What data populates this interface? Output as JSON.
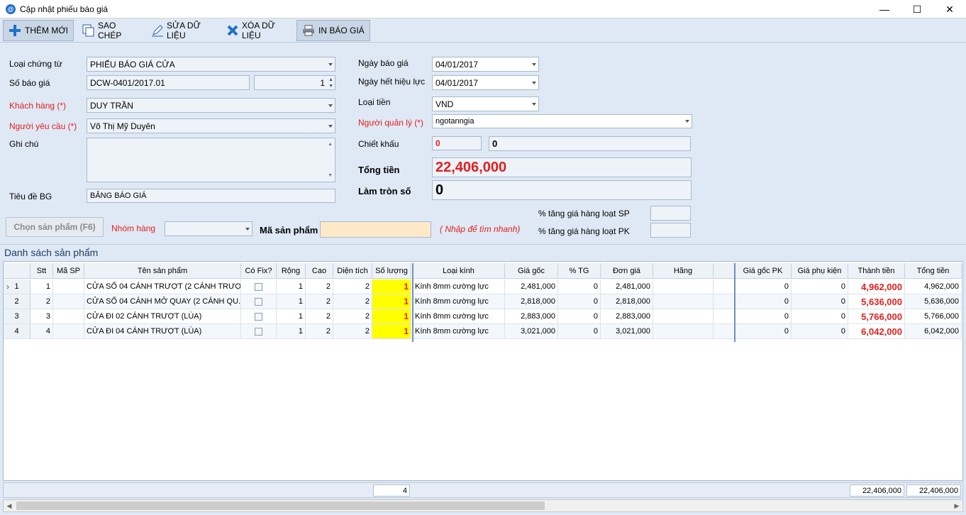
{
  "window": {
    "title": "Cập nhật phiếu báo giá"
  },
  "toolbar": {
    "add": "THÊM MỚI",
    "copy": "SAO CHÉP",
    "edit": "SỬA DỮ LIỆU",
    "delete": "XÓA DỮ LIỆU",
    "print": "IN BÁO GIÁ"
  },
  "form": {
    "doc_type_label": "Loại chứng từ",
    "doc_type_value": "PHIẾU BÁO GIÁ CỬA",
    "quote_no_label": "Số báo giá",
    "quote_no_value": "DCW-0401/2017.01",
    "quote_seq_value": "1",
    "customer_label": "Khách hàng (*)",
    "customer_value": "DUY TRẦN",
    "requester_label": "Người yêu cầu (*)",
    "requester_value": "Võ Thị Mỹ Duyên",
    "note_label": "Ghi chú",
    "note_value": "",
    "title_label": "Tiêu đề BG",
    "title_value": "BẢNG BÁO GIÁ",
    "quote_date_label": "Ngày báo giá",
    "quote_date_value": "04/01/2017",
    "expiry_label": "Ngày hết hiệu lực",
    "expiry_value": "04/01/2017",
    "currency_label": "Loại tiền",
    "currency_value": "VND",
    "manager_label": "Người quản lý (*)",
    "manager_value": "ngotanngia",
    "discount_label": "Chiết khấu",
    "discount_pct": "0",
    "discount_amount": "0",
    "total_label": "Tổng tiền",
    "total_value": "22,406,000",
    "rounding_label": "Làm tròn số",
    "rounding_value": "0",
    "pick_product_btn": "Chọn sản phẩm (F6)",
    "group_label": "Nhóm hàng",
    "group_value": "",
    "product_code_label": "Mã sản phẩm",
    "product_code_value": "",
    "quick_search_hint": "( Nhập để tìm nhanh)",
    "increase_sp_label": "% tăng giá hàng loạt SP",
    "increase_sp_value": "",
    "increase_pk_label": "% tăng giá hàng loạt PK",
    "increase_pk_value": ""
  },
  "grid": {
    "section_title": "Danh sách sản phẩm",
    "columns": [
      "Stt",
      "Mã SP",
      "Tên sản phẩm",
      "Có Fix?",
      "Rộng",
      "Cao",
      "Diện tích",
      "Số lượng",
      "Loại kính",
      "Giá gốc",
      "% TG",
      "Đơn giá",
      "Hãng",
      "",
      "Giá gốc PK",
      "Giá phụ kiện",
      "Thành tiền",
      "Tổng tiền"
    ],
    "rows": [
      {
        "hdr": "1",
        "stt": "1",
        "code": "",
        "name": "CỬA SỔ 04 CÁNH TRƯỢT (2 CÁNH TRƯỢ...",
        "fix": false,
        "w": "1",
        "h": "2",
        "area": "2",
        "qty": "1",
        "glass": "Kính 8mm cường lực",
        "base": "2,481,000",
        "tg": "0",
        "unit": "2,481,000",
        "brand": "",
        "extra": "",
        "pkbase": "0",
        "pk": "0",
        "amount": "4,962,000",
        "total": "4,962,000"
      },
      {
        "hdr": "2",
        "stt": "2",
        "code": "",
        "name": "CỬA SỔ 04 CÁNH MỞ QUAY (2 CÁNH QU...",
        "fix": false,
        "w": "1",
        "h": "2",
        "area": "2",
        "qty": "1",
        "glass": "Kính 8mm cường lực",
        "base": "2,818,000",
        "tg": "0",
        "unit": "2,818,000",
        "brand": "",
        "extra": "",
        "pkbase": "0",
        "pk": "0",
        "amount": "5,636,000",
        "total": "5,636,000"
      },
      {
        "hdr": "3",
        "stt": "3",
        "code": "",
        "name": "CỬA ĐI 02 CÁNH TRƯỢT (LÙA)",
        "fix": false,
        "w": "1",
        "h": "2",
        "area": "2",
        "qty": "1",
        "glass": "Kính 8mm cường lực",
        "base": "2,883,000",
        "tg": "0",
        "unit": "2,883,000",
        "brand": "",
        "extra": "",
        "pkbase": "0",
        "pk": "0",
        "amount": "5,766,000",
        "total": "5,766,000"
      },
      {
        "hdr": "4",
        "stt": "4",
        "code": "",
        "name": "CỬA ĐI 04 CÁNH TRƯỢT (LÙA)",
        "fix": false,
        "w": "1",
        "h": "2",
        "area": "2",
        "qty": "1",
        "glass": "Kính 8mm cường lực",
        "base": "3,021,000",
        "tg": "0",
        "unit": "3,021,000",
        "brand": "",
        "extra": "",
        "pkbase": "0",
        "pk": "0",
        "amount": "6,042,000",
        "total": "6,042,000"
      }
    ],
    "footer": {
      "qty_sum": "4",
      "amount_sum": "22,406,000",
      "total_sum": "22,406,000"
    }
  }
}
